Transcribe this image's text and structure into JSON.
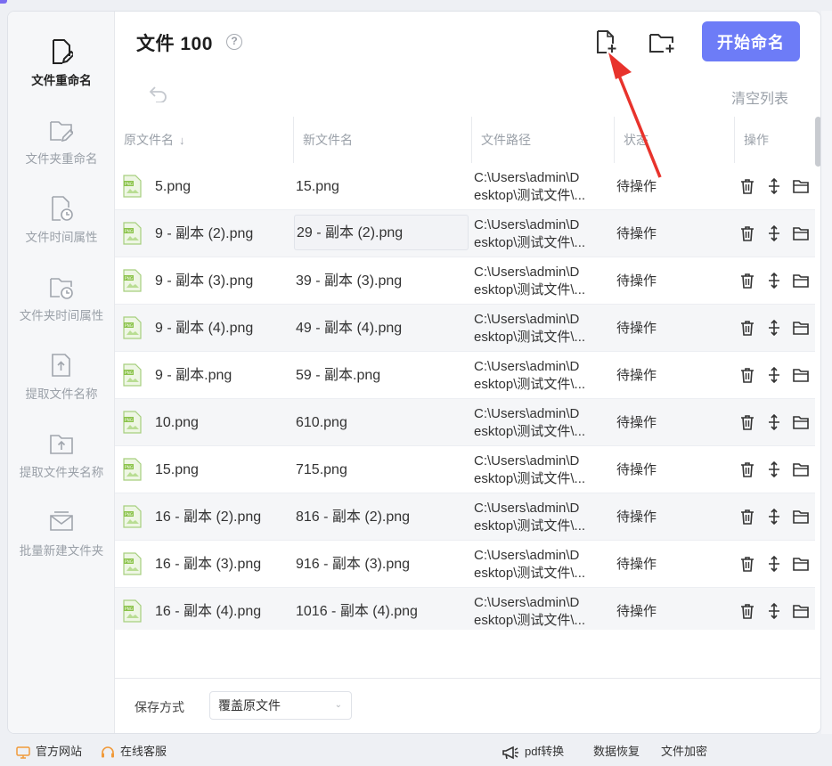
{
  "sidebar": {
    "items": [
      {
        "label": "文件重命名",
        "icon": "file-edit-icon",
        "active": true
      },
      {
        "label": "文件夹重命名",
        "icon": "folder-edit-icon"
      },
      {
        "label": "文件时间属性",
        "icon": "file-clock-icon"
      },
      {
        "label": "文件夹时间属性",
        "icon": "folder-clock-icon"
      },
      {
        "label": "提取文件名称",
        "icon": "file-upload-icon"
      },
      {
        "label": "提取文件夹名称",
        "icon": "folder-upload-icon"
      },
      {
        "label": "批量新建文件夹",
        "icon": "mail-folder-icon"
      }
    ]
  },
  "header": {
    "title": "文件 100",
    "help_icon": "?",
    "start_button": "开始命名",
    "clear_list": "清空列表"
  },
  "table": {
    "columns": [
      "原文件名",
      "新文件名",
      "文件路径",
      "状态",
      "操作"
    ],
    "sort_icon": "↓",
    "rows": [
      {
        "original": "5.png",
        "new": "15.png",
        "path1": "C:\\Users\\admin\\D",
        "path2": "esktop\\测试文件\\...",
        "status": "待操作"
      },
      {
        "original": "9 - 副本 (2).png",
        "new": "29 - 副本 (2).png",
        "path1": "C:\\Users\\admin\\D",
        "path2": "esktop\\测试文件\\...",
        "status": "待操作"
      },
      {
        "original": "9 - 副本 (3).png",
        "new": "39 - 副本 (3).png",
        "path1": "C:\\Users\\admin\\D",
        "path2": "esktop\\测试文件\\...",
        "status": "待操作"
      },
      {
        "original": "9 - 副本 (4).png",
        "new": "49 - 副本 (4).png",
        "path1": "C:\\Users\\admin\\D",
        "path2": "esktop\\测试文件\\...",
        "status": "待操作"
      },
      {
        "original": "9 - 副本.png",
        "new": "59 - 副本.png",
        "path1": "C:\\Users\\admin\\D",
        "path2": "esktop\\测试文件\\...",
        "status": "待操作"
      },
      {
        "original": "10.png",
        "new": "610.png",
        "path1": "C:\\Users\\admin\\D",
        "path2": "esktop\\测试文件\\...",
        "status": "待操作"
      },
      {
        "original": "15.png",
        "new": "715.png",
        "path1": "C:\\Users\\admin\\D",
        "path2": "esktop\\测试文件\\...",
        "status": "待操作"
      },
      {
        "original": "16 - 副本 (2).png",
        "new": "816 - 副本 (2).png",
        "path1": "C:\\Users\\admin\\D",
        "path2": "esktop\\测试文件\\...",
        "status": "待操作"
      },
      {
        "original": "16 - 副本 (3).png",
        "new": "916 - 副本 (3).png",
        "path1": "C:\\Users\\admin\\D",
        "path2": "esktop\\测试文件\\...",
        "status": "待操作"
      },
      {
        "original": "16 - 副本 (4).png",
        "new": "1016 - 副本 (4).png",
        "path1": "C:\\Users\\admin\\D",
        "path2": "esktop\\测试文件\\...",
        "status": "待操作"
      }
    ]
  },
  "bottom": {
    "save_label": "保存方式",
    "save_value": "覆盖原文件",
    "save_chevron": "⌄"
  },
  "footer": {
    "official_site": "官方网站",
    "online_service": "在线客服",
    "pdf_convert": "pdf转换",
    "data_recovery": "数据恢复",
    "file_encrypt": "文件加密"
  },
  "colors": {
    "accent": "#6d7cf7",
    "annotation_arrow": "#e8332c",
    "png_icon": "#8bc34a"
  }
}
